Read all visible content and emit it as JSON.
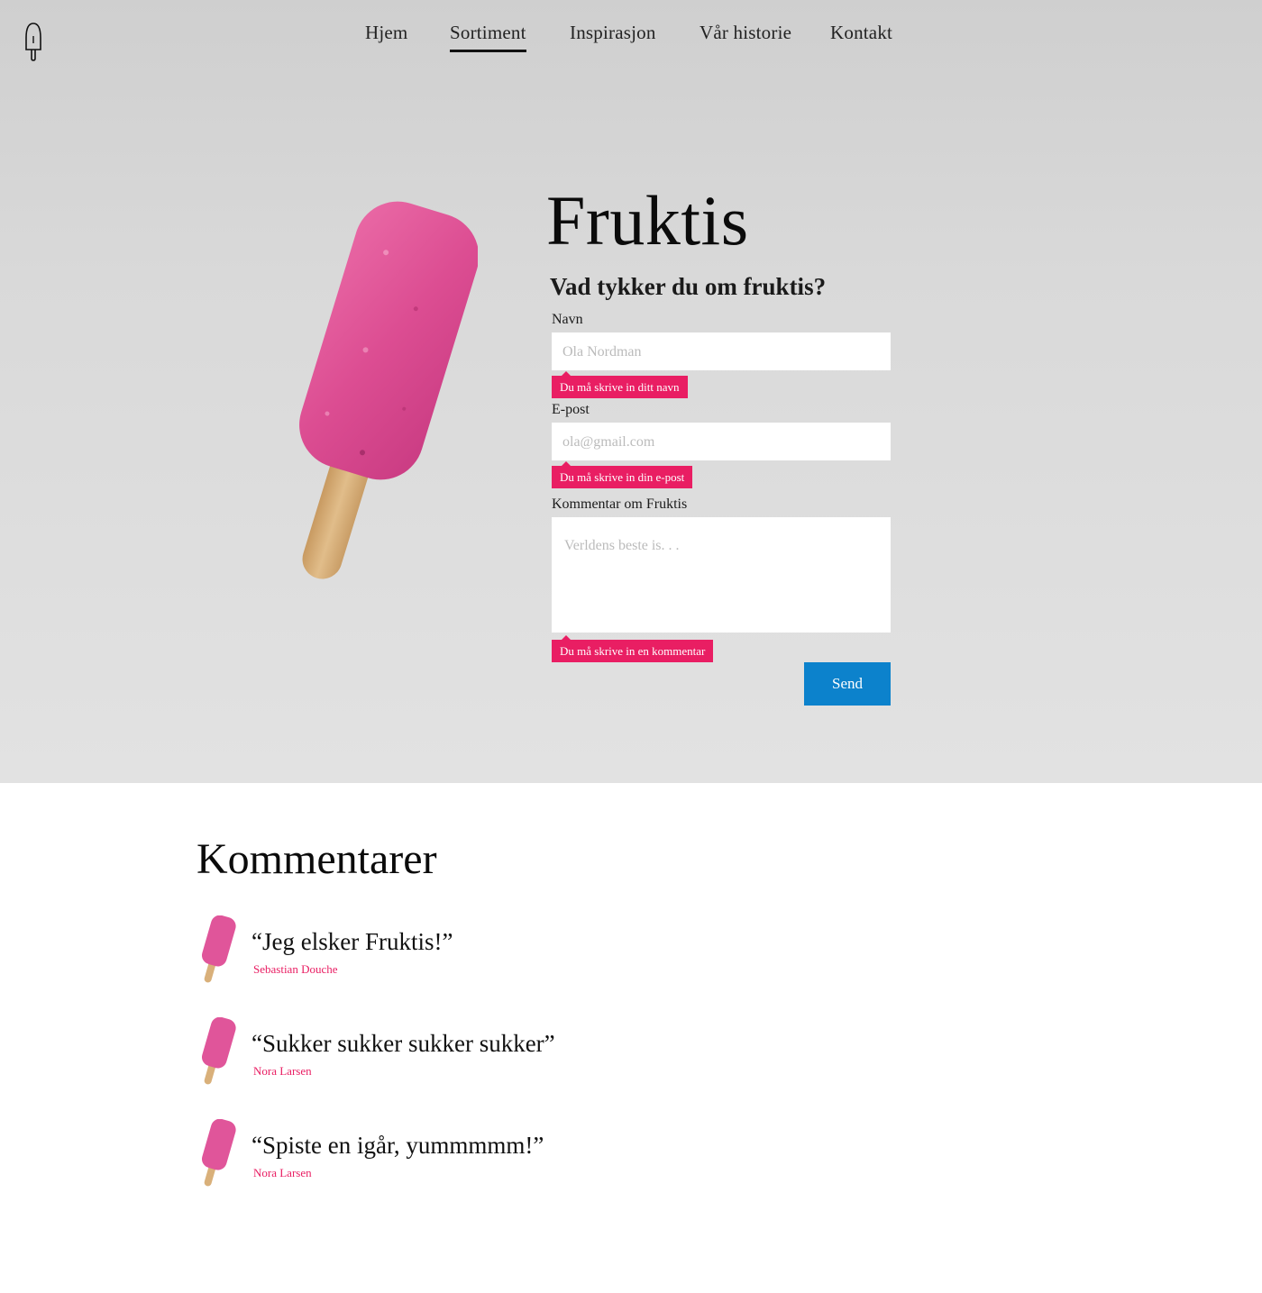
{
  "nav": {
    "items": [
      {
        "label": "Hjem",
        "active": false
      },
      {
        "label": "Sortiment",
        "active": true
      },
      {
        "label": "Inspirasjon",
        "active": false
      },
      {
        "label": "Vår historie",
        "active": false
      },
      {
        "label": "Kontakt",
        "active": false
      }
    ]
  },
  "logo": {
    "icon": "popsicle-outline-icon"
  },
  "product": {
    "title": "Fruktis",
    "image": "pink-popsicle-icon"
  },
  "form": {
    "heading": "Vad tykker du om fruktis?",
    "name": {
      "label": "Navn",
      "placeholder": "Ola Nordman",
      "error": "Du må skrive in ditt navn"
    },
    "email": {
      "label": "E-post",
      "placeholder": "ola@gmail.com",
      "error": "Du må skrive in din e-post"
    },
    "comment": {
      "label": "Kommentar om Fruktis",
      "placeholder": "Verldens beste is. . .",
      "error": "Du må skrive in en kommentar"
    },
    "submit_label": "Send"
  },
  "comments": {
    "heading": "Kommentarer",
    "items": [
      {
        "text": "“Jeg elsker Fruktis!”",
        "author": "Sebastian Douche",
        "icon": "pink-popsicle-icon"
      },
      {
        "text": "“Sukker sukker sukker sukker”",
        "author": "Nora Larsen",
        "icon": "pink-popsicle-icon"
      },
      {
        "text": "“Spiste en igår, yummmmm!”",
        "author": "Nora Larsen",
        "icon": "pink-popsicle-icon"
      }
    ]
  },
  "colors": {
    "accent": "#e91e63",
    "button": "#0c82cc",
    "popsicle_pink": "#e0559a",
    "stick": "#d9b07a"
  }
}
